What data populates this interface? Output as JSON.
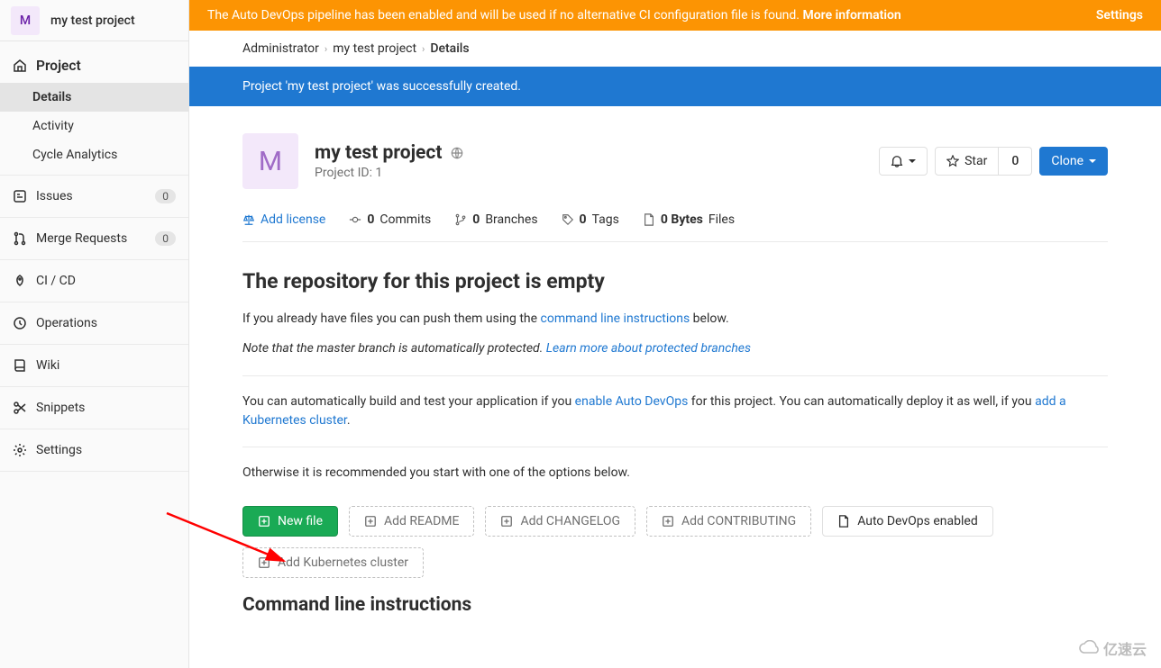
{
  "project_short": "M",
  "project_name": "my test project",
  "sidebar": {
    "heading": "Project",
    "sub": {
      "details": "Details",
      "activity": "Activity",
      "cycle": "Cycle Analytics"
    },
    "issues": {
      "label": "Issues",
      "count": "0"
    },
    "mr": {
      "label": "Merge Requests",
      "count": "0"
    },
    "cicd": "CI / CD",
    "operations": "Operations",
    "wiki": "Wiki",
    "snippets": "Snippets",
    "settings": "Settings"
  },
  "auto_devops": {
    "text": "The Auto DevOps pipeline has been enabled and will be used if no alternative CI configuration file is found. ",
    "more": "More information",
    "settings": "Settings"
  },
  "breadcrumb": {
    "a": "Administrator",
    "b": "my test project",
    "c": "Details"
  },
  "success": "Project 'my test project' was successfully created.",
  "header": {
    "title": "my test project",
    "id_label": "Project ID: 1",
    "star": "Star",
    "star_count": "0",
    "clone": "Clone"
  },
  "stats": {
    "license": "Add license",
    "commits_n": "0",
    "commits": " Commits",
    "branches_n": "0",
    "branches": " Branches",
    "tags_n": "0",
    "tags": " Tags",
    "files_n": "0 Bytes",
    "files": " Files"
  },
  "empty": {
    "title": "The repository for this project is empty",
    "p1a": "If you already have files you can push them using the ",
    "p1link": "command line instructions",
    "p1b": " below.",
    "p2a": "Note that the master branch is automatically protected. ",
    "p2link": "Learn more about protected branches",
    "p3a": "You can automatically build and test your application if you ",
    "p3link1": "enable Auto DevOps",
    "p3b": " for this project. You can automatically deploy it as well, if you ",
    "p3link2": "add a Kubernetes cluster",
    "p3c": ".",
    "p4": "Otherwise it is recommended you start with one of the options below."
  },
  "buttons": {
    "new_file": "New file",
    "readme": "Add README",
    "changelog": "Add CHANGELOG",
    "contributing": "Add CONTRIBUTING",
    "auto_devops": "Auto DevOps enabled",
    "k8s": "Add Kubernetes cluster"
  },
  "cli_title": "Command line instructions",
  "watermark": "亿速云"
}
